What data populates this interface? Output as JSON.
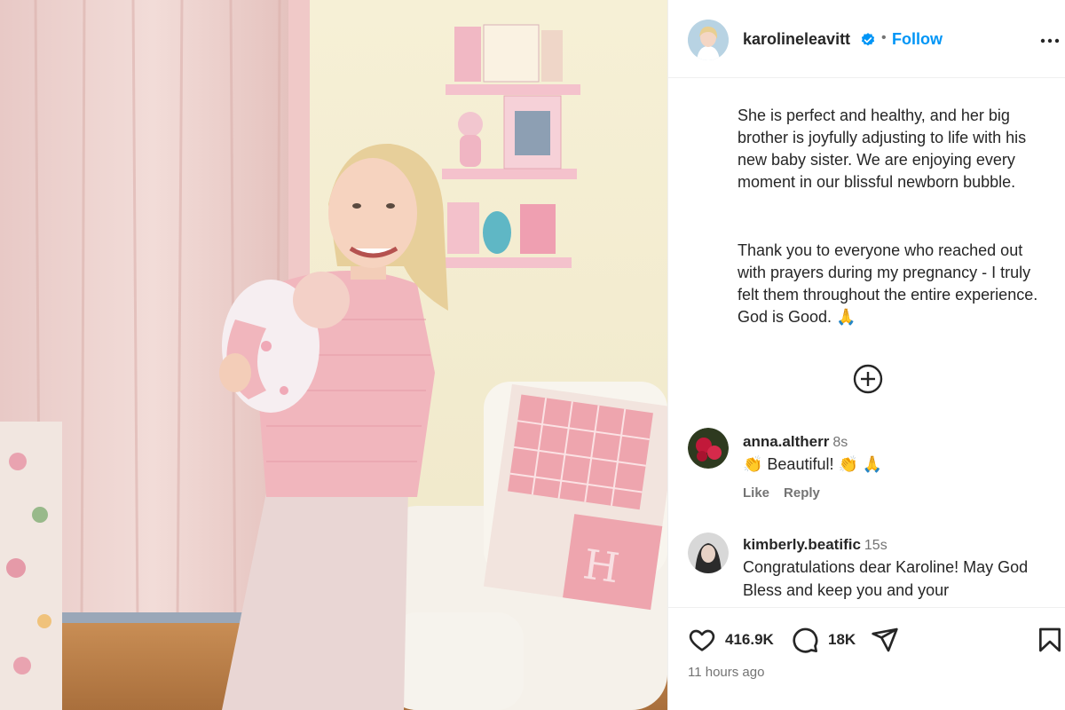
{
  "post": {
    "username": "karolineleavitt",
    "follow_label": "Follow",
    "separator": "•",
    "caption_paragraphs": [
      "She is perfect and healthy, and her big brother is joyfully adjusting to life with his new baby sister. We are enjoying every moment in our blissful newborn bubble.",
      "Thank you to everyone who reached out with prayers during my pregnancy - I truly felt them throughout the entire experience. God is Good. 🙏"
    ]
  },
  "comments": [
    {
      "username": "anna.altherr",
      "time": "8s",
      "text": "👏 Beautiful! 👏 🙏",
      "like_label": "Like",
      "reply_label": "Reply"
    },
    {
      "username": "kimberly.beatific",
      "time": "15s",
      "text": "Congratulations dear Karoline! May God Bless and keep you and your"
    }
  ],
  "footer": {
    "likes": "416.9K",
    "comments": "18K",
    "timestamp": "11 hours ago"
  },
  "icons": {
    "verified": "verified-badge-icon",
    "more": "more-options-icon",
    "add_comment": "plus-circle-icon",
    "like": "heart-icon",
    "comment": "comment-bubble-icon",
    "share": "paper-plane-icon",
    "save": "bookmark-icon"
  },
  "colors": {
    "follow": "#0095f6",
    "verified": "#0095f6",
    "muted": "#737373"
  }
}
